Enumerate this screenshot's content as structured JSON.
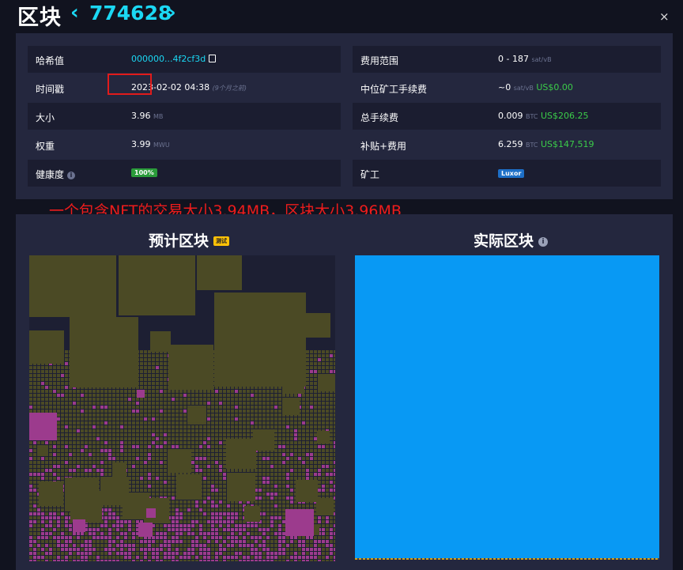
{
  "header": {
    "title": "区块",
    "prev_glyph": "‹",
    "block_height": "774628",
    "next_glyph": "›",
    "close_glyph": "×"
  },
  "details": {
    "left": {
      "hash_label": "哈希值",
      "hash_value": "000000...4f2cf3d",
      "timestamp_label": "时间戳",
      "timestamp_value": "2023-02-02 04:38",
      "timestamp_relative": "(9个月之前)",
      "size_label": "大小",
      "size_value": "3.96",
      "size_unit": "MB",
      "weight_label": "权重",
      "weight_value": "3.99",
      "weight_unit": "MWU",
      "health_label": "健康度",
      "health_info": "i",
      "health_value": "100%"
    },
    "right": {
      "fee_range_label": "费用范围",
      "fee_range_value": "0 - 187",
      "fee_range_unit": "sat/vB",
      "median_fee_label": "中位矿工手续费",
      "median_fee_value": "~0",
      "median_fee_unit": "sat/vB",
      "median_fee_fiat": "US$0.00",
      "total_fees_label": "总手续费",
      "total_fees_value": "0.009",
      "total_fees_unit": "BTC",
      "total_fees_fiat": "US$206.25",
      "subsidy_label": "补贴+费用",
      "subsidy_value": "6.259",
      "subsidy_unit": "BTC",
      "subsidy_fiat": "US$147,519",
      "miner_label": "矿工",
      "miner_value": "Luxor"
    }
  },
  "annotation": "一个包含NFT的交易大小3.94MB，区块大小3.96MB",
  "projected": {
    "title": "预计区块",
    "badge": "测试"
  },
  "actual": {
    "title": "实际区块",
    "info": "i"
  },
  "colors": {
    "olive": "#4b4a25",
    "magenta": "#9c3b8d",
    "actual_blue": "#0899f4",
    "accent": "#1bd8f4",
    "fiat_green": "#3bcc49"
  }
}
